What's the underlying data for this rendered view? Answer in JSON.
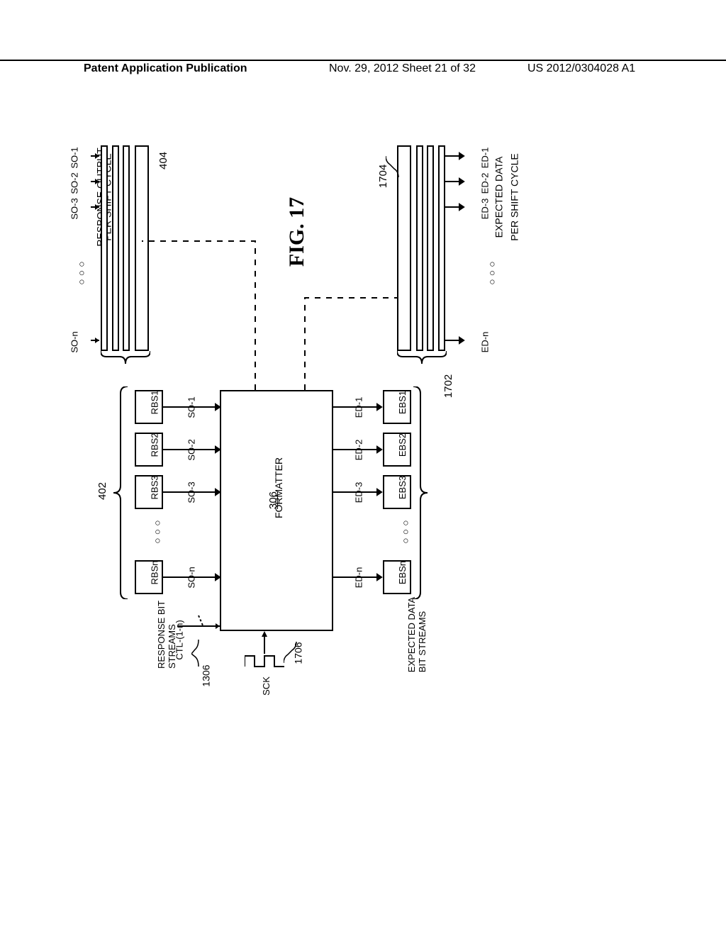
{
  "header": {
    "left": "Patent Application Publication",
    "mid": "Nov. 29, 2012  Sheet 21 of 32",
    "right": "US 2012/0304028 A1"
  },
  "fig_title": "FIG. 17",
  "left_block": {
    "header1": "RESPONSE OUTPUT",
    "header2": "PER SHIFT CYCLE",
    "ref": "404",
    "inputs": [
      "SO-1",
      "SO-2",
      "SO-3",
      "SO-n"
    ],
    "streams": [
      "RBS1",
      "RBS2",
      "RBS3",
      "RBSn"
    ],
    "stream_outputs": [
      "SO-1",
      "SO-2",
      "SO-3",
      "SO-n"
    ],
    "group_ref": "402",
    "group_label": "RESPONSE BIT\nSTREAMS"
  },
  "formatter": {
    "label": "FORMATTER",
    "ref": "306"
  },
  "right_block": {
    "header1": "EXPECTED DATA",
    "header2": "PER SHIFT CYCLE",
    "ref": "1704",
    "outputs": [
      "ED-1",
      "ED-2",
      "ED-3",
      "ED-n"
    ],
    "stream_inputs": [
      "ED-1",
      "ED-2",
      "ED-3",
      "ED-n"
    ],
    "streams": [
      "EBS1",
      "EBS2",
      "EBS3",
      "EBSn"
    ],
    "group_ref": "1702",
    "group_label": "EXPECTED DATA\nBIT STREAMS"
  },
  "ctl": {
    "label": "CTL-(1-n)",
    "ref": "1306"
  },
  "sck": {
    "label": "SCK",
    "ref": "1706"
  }
}
